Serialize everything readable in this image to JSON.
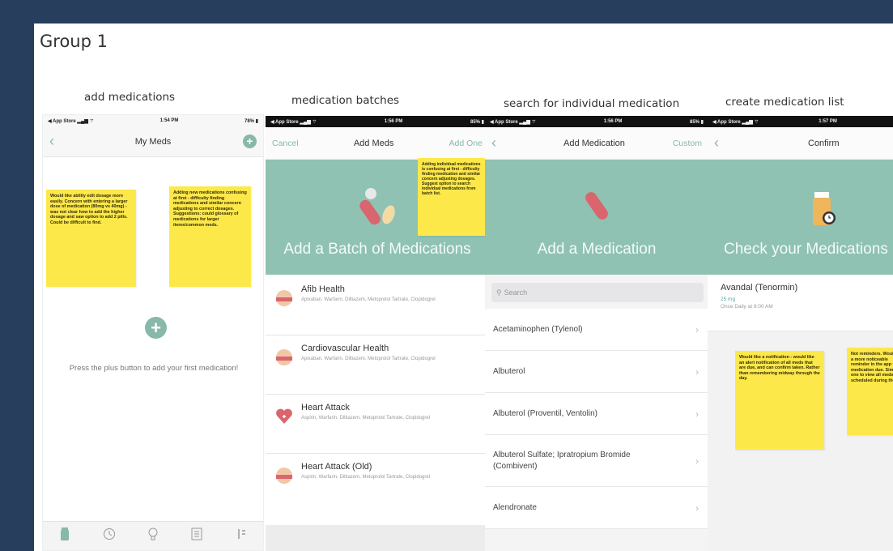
{
  "board": {
    "title": "Group 1"
  },
  "frames": [
    {
      "caption": "add medications",
      "statusbar": {
        "left": "◀ App Store  ▂▄▆ ⌔",
        "center": "1:54 PM",
        "right": "78% ▮"
      },
      "nav": {
        "back": "‹",
        "title": "My Meds",
        "action": "+"
      },
      "stickies": [
        "Would like ability edit dosage more easily. Concern with entering a larger dose of medication (80mg vs 40mg) - was not clear how to add the higher dosage and saw option to add 2 pills. Could be difficult to find.",
        "Adding new medications confusing at first - difficulty finding medications and similar concern adjusting to correct dosages. Suggestions: could glossary of medications for larger items/common meds."
      ],
      "empty_text": "Press the plus button to add your first medication!",
      "tabs": [
        "pill-bottle-icon",
        "clock-icon",
        "lightbulb-icon",
        "list-icon",
        "profile-icon"
      ]
    },
    {
      "caption": "medication batches",
      "statusbar": {
        "left": "◀ App Store  ▂▄▆ ⌔",
        "center": "1:56 PM",
        "right": "85% ▮"
      },
      "nav": {
        "cancel": "Cancel",
        "title": "Add Meds",
        "action": "Add One"
      },
      "hero_text": "Add a Batch of Medications",
      "sticky": "Adding individual medications is confusing at first - difficulty finding medication and similar concern adjusting dosages. Suggest option to search individual medications from batch list.",
      "batches": [
        {
          "title": "Afib Health",
          "sub": "Apixaban, Warfarin, Diltiazem, Metoprolol Tartrate, Clopidogrel"
        },
        {
          "title": "Cardiovascular Health",
          "sub": "Apixaban, Warfarin, Diltiazem, Metoprolol Tartrate, Clopidogrel"
        },
        {
          "title": "Heart Attack",
          "sub": "Aspirin, Warfarin, Diltiazem, Metoprolol Tartrate, Clopidogrel"
        },
        {
          "title": "Heart Attack (Old)",
          "sub": "Aspirin, Warfarin, Diltiazem, Metoprolol Tartrate, Clopidogrel"
        }
      ]
    },
    {
      "caption": "search for individual medication",
      "statusbar": {
        "left": "◀ App Store  ▂▄▆ ⌔",
        "center": "1:56 PM",
        "right": "85% ▮"
      },
      "nav": {
        "back": "‹",
        "title": "Add Medication",
        "action": "Custom"
      },
      "hero_text": "Add a Medication",
      "search_placeholder": "Search",
      "meds": [
        "Acetaminophen (Tylenol)",
        "Albuterol",
        "Albuterol (Proventil, Ventolin)",
        "Albuterol Sulfate; Ipratropium Bromide (Combivent)",
        "Alendronate"
      ]
    },
    {
      "caption": "create medication list",
      "statusbar": {
        "left": "◀ App Store  ▂▄▆ ⌔",
        "center": "1:57 PM",
        "right": ""
      },
      "nav": {
        "back": "‹",
        "title": "Confirm"
      },
      "hero_text": "Check your Medications",
      "med": {
        "name": "Avandal (Tenormin)",
        "dose": "25 mg",
        "schedule": "Once Daily at 8:00 AM"
      },
      "stickies": [
        "Would like a notification - would like an alert notification of all meds that are due, and can confirm taken. Rather than remembering midway through the day.",
        "Not reminders. Would like a more noticeable reminder in the app for medication due. Similarly, one to view all meds scheduled during the day."
      ]
    }
  ],
  "colors": {
    "background": "#273e5d",
    "teal": "#8fc2b2",
    "sticky": "#fde84a"
  }
}
